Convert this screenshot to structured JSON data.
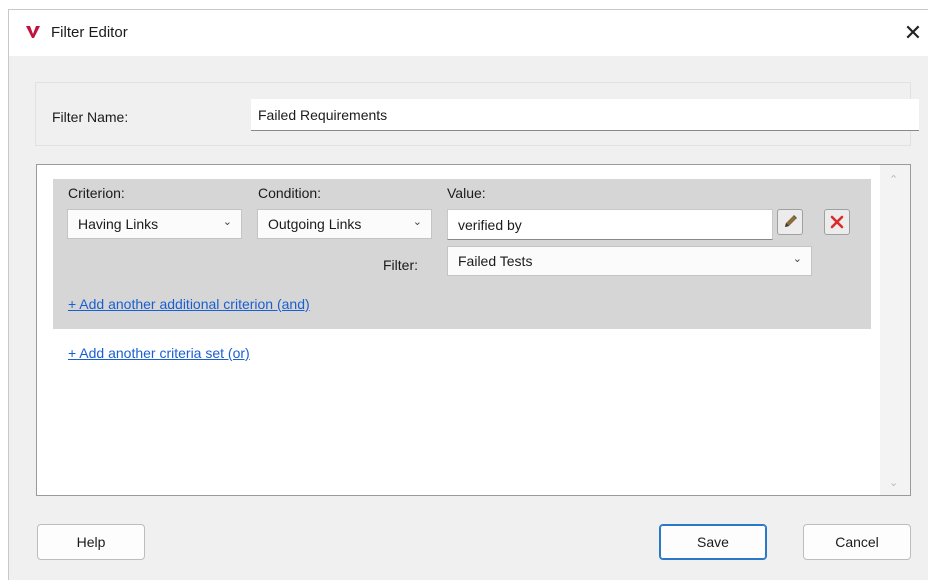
{
  "window": {
    "title": "Filter Editor",
    "close_symbol": "✕",
    "logo_icon": "v-logo-icon",
    "logo_color": "#c0143c"
  },
  "filter_name": {
    "label": "Filter Name:",
    "value": "Failed Requirements"
  },
  "criteria_set": {
    "criterion_label": "Criterion:",
    "condition_label": "Condition:",
    "value_label": "Value:",
    "criterion_selected": "Having Links",
    "condition_selected": "Outgoing Links",
    "value": "verified by",
    "filter_label": "Filter:",
    "filter_selected": "Failed Tests",
    "add_and_link": "+ Add another additional criterion (and)"
  },
  "add_or_link": "+ Add another criteria set (or)",
  "buttons": {
    "help": "Help",
    "save": "Save",
    "cancel": "Cancel"
  },
  "icons": {
    "edit": "pencil-icon",
    "delete": "red-x-icon",
    "chevron": "chevron-down-icon",
    "scroll_up": "scroll-up-icon",
    "scroll_down": "scroll-down-icon"
  },
  "colors": {
    "link": "#1a5fd1",
    "delete_red": "#d92b2b",
    "primary_border": "#2b78c8",
    "criteria_set_bg": "#d6d6d6"
  }
}
